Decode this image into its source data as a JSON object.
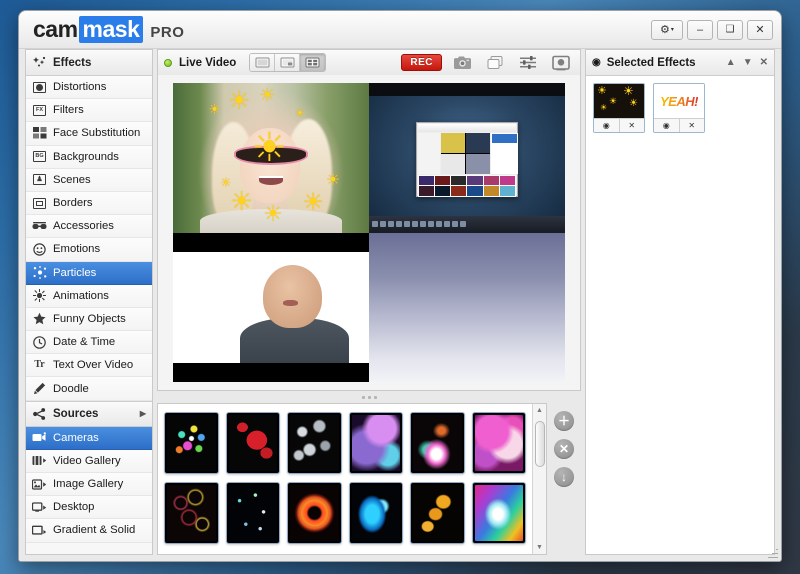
{
  "app": {
    "logo_cam": "cam",
    "logo_mask": "mask",
    "logo_pro": "PRO"
  },
  "titlebar": {
    "settings_label": "⚙",
    "settings_caret": "▾",
    "minimize_label": "–",
    "maximize_label": "❑",
    "close_label": "✕"
  },
  "sidebar": {
    "effects_header": "Effects",
    "effects_items": [
      {
        "label": "Distortions",
        "icon": "distortions-icon"
      },
      {
        "label": "Filters",
        "icon": "fx-icon"
      },
      {
        "label": "Face Substitution",
        "icon": "face-substitution-icon"
      },
      {
        "label": "Backgrounds",
        "icon": "bg-icon"
      },
      {
        "label": "Scenes",
        "icon": "scenes-icon"
      },
      {
        "label": "Borders",
        "icon": "borders-icon"
      },
      {
        "label": "Accessories",
        "icon": "accessories-icon"
      },
      {
        "label": "Emotions",
        "icon": "smiley-icon"
      },
      {
        "label": "Particles",
        "icon": "particles-icon"
      },
      {
        "label": "Animations",
        "icon": "animations-icon"
      },
      {
        "label": "Funny Objects",
        "icon": "star-icon"
      },
      {
        "label": "Date & Time",
        "icon": "clock-icon"
      },
      {
        "label": "Text Over Video",
        "icon": "text-icon"
      },
      {
        "label": "Doodle",
        "icon": "pencil-icon"
      }
    ],
    "active_effect": "Particles",
    "sources_header": "Sources",
    "sources_arrow": "▶",
    "sources_items": [
      {
        "label": "Cameras",
        "icon": "camera-icon"
      },
      {
        "label": "Video Gallery",
        "icon": "video-gallery-icon"
      },
      {
        "label": "Image Gallery",
        "icon": "image-gallery-icon"
      },
      {
        "label": "Desktop",
        "icon": "desktop-icon"
      },
      {
        "label": "Gradient & Solid",
        "icon": "gradient-solid-icon"
      }
    ],
    "active_source": "Cameras"
  },
  "toolbar": {
    "status_label": "Live Video",
    "layout_modes": [
      {
        "name": "single-view",
        "active": false
      },
      {
        "name": "pip-view",
        "active": false
      },
      {
        "name": "grid-view",
        "active": true
      }
    ],
    "rec_label": "REC",
    "icons": [
      {
        "name": "snapshot-icon"
      },
      {
        "name": "layers-icon"
      },
      {
        "name": "settings-sliders-icon"
      },
      {
        "name": "broadcast-icon"
      }
    ]
  },
  "video": {
    "quadrants": [
      {
        "name": "webcam-girl-sun-particles"
      },
      {
        "name": "desktop-capture"
      },
      {
        "name": "video-gallery-man"
      },
      {
        "name": "gradient-solid"
      }
    ]
  },
  "right_panel": {
    "title": "Selected Effects",
    "eye_icon": "◉",
    "move_up": "▲",
    "move_down": "▼",
    "close": "✕",
    "effects": [
      {
        "name": "sun-particles-effect",
        "eye": "◉",
        "remove": "✕"
      },
      {
        "name": "yeah-text-effect",
        "label": "YEAH!",
        "eye": "◉",
        "remove": "✕"
      }
    ]
  },
  "gallery": {
    "buttons": [
      {
        "name": "add-effect-button",
        "label": "＋"
      },
      {
        "name": "remove-effect-button",
        "label": "✕"
      },
      {
        "name": "download-effect-button",
        "label": "↓"
      }
    ],
    "scroll_up": "▲",
    "scroll_down": "▼",
    "thumbnails": [
      {
        "name": "confetti-particles",
        "css": "radial-gradient(circle at 30% 35%, #49e0c0 0 3px, transparent 4px), radial-gradient(circle at 55% 25%, #f3e23a 0 3px, transparent 4px), radial-gradient(circle at 42% 55%, #e84fd0 0 4px, transparent 5px), radial-gradient(circle at 65% 60%, #6ad84f 0 3px, transparent 4px), radial-gradient(circle at 25% 62%, #f07c2a 0 3px, transparent 4px), radial-gradient(circle at 70% 40%, #4fa6ef 0 3px, transparent 4px), radial-gradient(circle at 50% 42%, #fff 0 2px, transparent 3px), #050505"
      },
      {
        "name": "kabuki-mask-particles",
        "css": "radial-gradient(ellipse 30% 24% at 58% 45%, #d8202a 0 70%, transparent 72%), radial-gradient(ellipse 18% 14% at 78% 68%, #c41c24 0 70%, transparent 72%), radial-gradient(ellipse 16% 12% at 28% 22%, #cf2029 0 70%, transparent 72%), #060606"
      },
      {
        "name": "bubbles-grey-particles",
        "css": "radial-gradient(circle at 25% 30%, #d8dce0 0 4px, transparent 6px), radial-gradient(circle at 60% 20%, #b7bdc4 0 5px, transparent 7px), radial-gradient(circle at 40% 62%, #cfd4da 0 5px, transparent 7px), radial-gradient(circle at 72% 55%, #9aa2aa 0 4px, transparent 6px), radial-gradient(circle at 18% 72%, #c2c8ce 0 4px, transparent 6px), #070707"
      },
      {
        "name": "purple-orbs-particles",
        "css": "radial-gradient(circle at 62% 24%, #d88df0 0 14px, transparent 20px), radial-gradient(circle at 30% 58%, #8a6ad0 0 16px, transparent 24px), radial-gradient(circle at 75% 72%, #5fd0e8 0 10px, transparent 16px), #1a0b2a"
      },
      {
        "name": "pink-flame-particles",
        "css": "radial-gradient(ellipse 40% 38% at 48% 70%, #ffffff 0 25%, #f36ad0 45%, transparent 72%), radial-gradient(ellipse 30% 25% at 30% 62%, #3ecfb0 0 30%, transparent 70%), radial-gradient(ellipse 25% 20% at 58% 28%, #e06a2a 0 30%, transparent 70%), #0a0608"
      },
      {
        "name": "magenta-bokeh-particles",
        "css": "radial-gradient(circle at 35% 30%, #f05fd0 0 16px, transparent 22px), radial-gradient(circle at 68% 52%, #f8d8e8 0 14px, transparent 20px), radial-gradient(circle at 22% 70%, #c050c8 0 12px, transparent 18px), radial-gradient(circle at 78% 22%, #e84fb8 0 10px, transparent 16px), #7a1a66"
      },
      {
        "name": "red-rings-particles",
        "css": "radial-gradient(circle at 28% 32%, transparent 5px, #a8324a 6px, transparent 8px), radial-gradient(circle at 58% 22%, transparent 6px, #b8a02a 7px, transparent 9px), radial-gradient(circle at 45% 58%, transparent 6px, #a82a3a 7px, transparent 9px), radial-gradient(circle at 72% 70%, transparent 5px, #c0a83a 6px, transparent 8px), #0c0506"
      },
      {
        "name": "starfield-particles",
        "css": "radial-gradient(circle at 22% 28%, #6ad8e0 0 1.5px, transparent 2px), radial-gradient(circle at 55% 18%, #a8f0c0 0 1.5px, transparent 2px), radial-gradient(circle at 72% 48%, #e0e8f0 0 1.5px, transparent 2px), radial-gradient(circle at 35% 70%, #80c0e8 0 1.5px, transparent 2px), radial-gradient(circle at 65% 78%, #c0d8f0 0 1.5px, transparent 2px), #020306"
      },
      {
        "name": "orange-flower-particles",
        "css": "radial-gradient(circle at 50% 50%, transparent 6px, #ff4a1e 8px, #ff8a2a 13px, transparent 18px), radial-gradient(circle at 50% 50%, transparent 13px, #e8321a 15px, transparent 20px), #090303"
      },
      {
        "name": "blue-splash-particles",
        "css": "radial-gradient(ellipse 35% 40% at 42% 52%, #2ed0ff 0 40%, #0a6ac0 70%, transparent 85%), radial-gradient(circle at 62% 38%, #7fe8ff 0 5px, transparent 8px), #020408"
      },
      {
        "name": "gold-smoke-particles",
        "css": "radial-gradient(ellipse 22% 18% at 62% 30%, #f0a820 0 60%, transparent 75%), radial-gradient(ellipse 20% 16% at 46% 52%, #e8981a 0 60%, transparent 75%), radial-gradient(ellipse 18% 14% at 30% 74%, #f2b030 0 60%, transparent 75%), #060402"
      },
      {
        "name": "rainbow-blur-particles",
        "css": "radial-gradient(ellipse 45% 45% at 48% 52%, #ffffff 0 22%, #9ae8f0 42%, transparent 62%), linear-gradient(125deg, #e02a8a 0%, #b03ad0 22%, #3a7ae0 48%, #2ad0a0 66%, #f0c020 84%, #e8502a 100%)"
      }
    ]
  }
}
